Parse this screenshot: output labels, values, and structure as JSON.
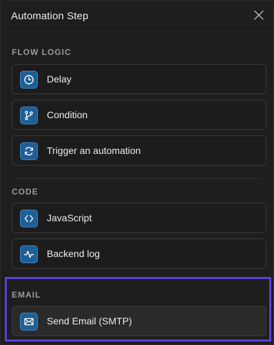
{
  "header": {
    "title": "Automation Step"
  },
  "sections": [
    {
      "label": "FLOW LOGIC",
      "items": [
        {
          "label": "Delay",
          "icon": "clock-icon"
        },
        {
          "label": "Condition",
          "icon": "branch-icon"
        },
        {
          "label": "Trigger an automation",
          "icon": "refresh-icon"
        }
      ]
    },
    {
      "label": "CODE",
      "items": [
        {
          "label": "JavaScript",
          "icon": "code-icon"
        },
        {
          "label": "Backend log",
          "icon": "pulse-icon"
        }
      ]
    },
    {
      "label": "EMAIL",
      "items": [
        {
          "label": "Send Email (SMTP)",
          "icon": "mail-icon"
        }
      ]
    }
  ],
  "colors": {
    "accent_highlight": "#5b3fe0",
    "icon_bg": "#1f5f95"
  }
}
